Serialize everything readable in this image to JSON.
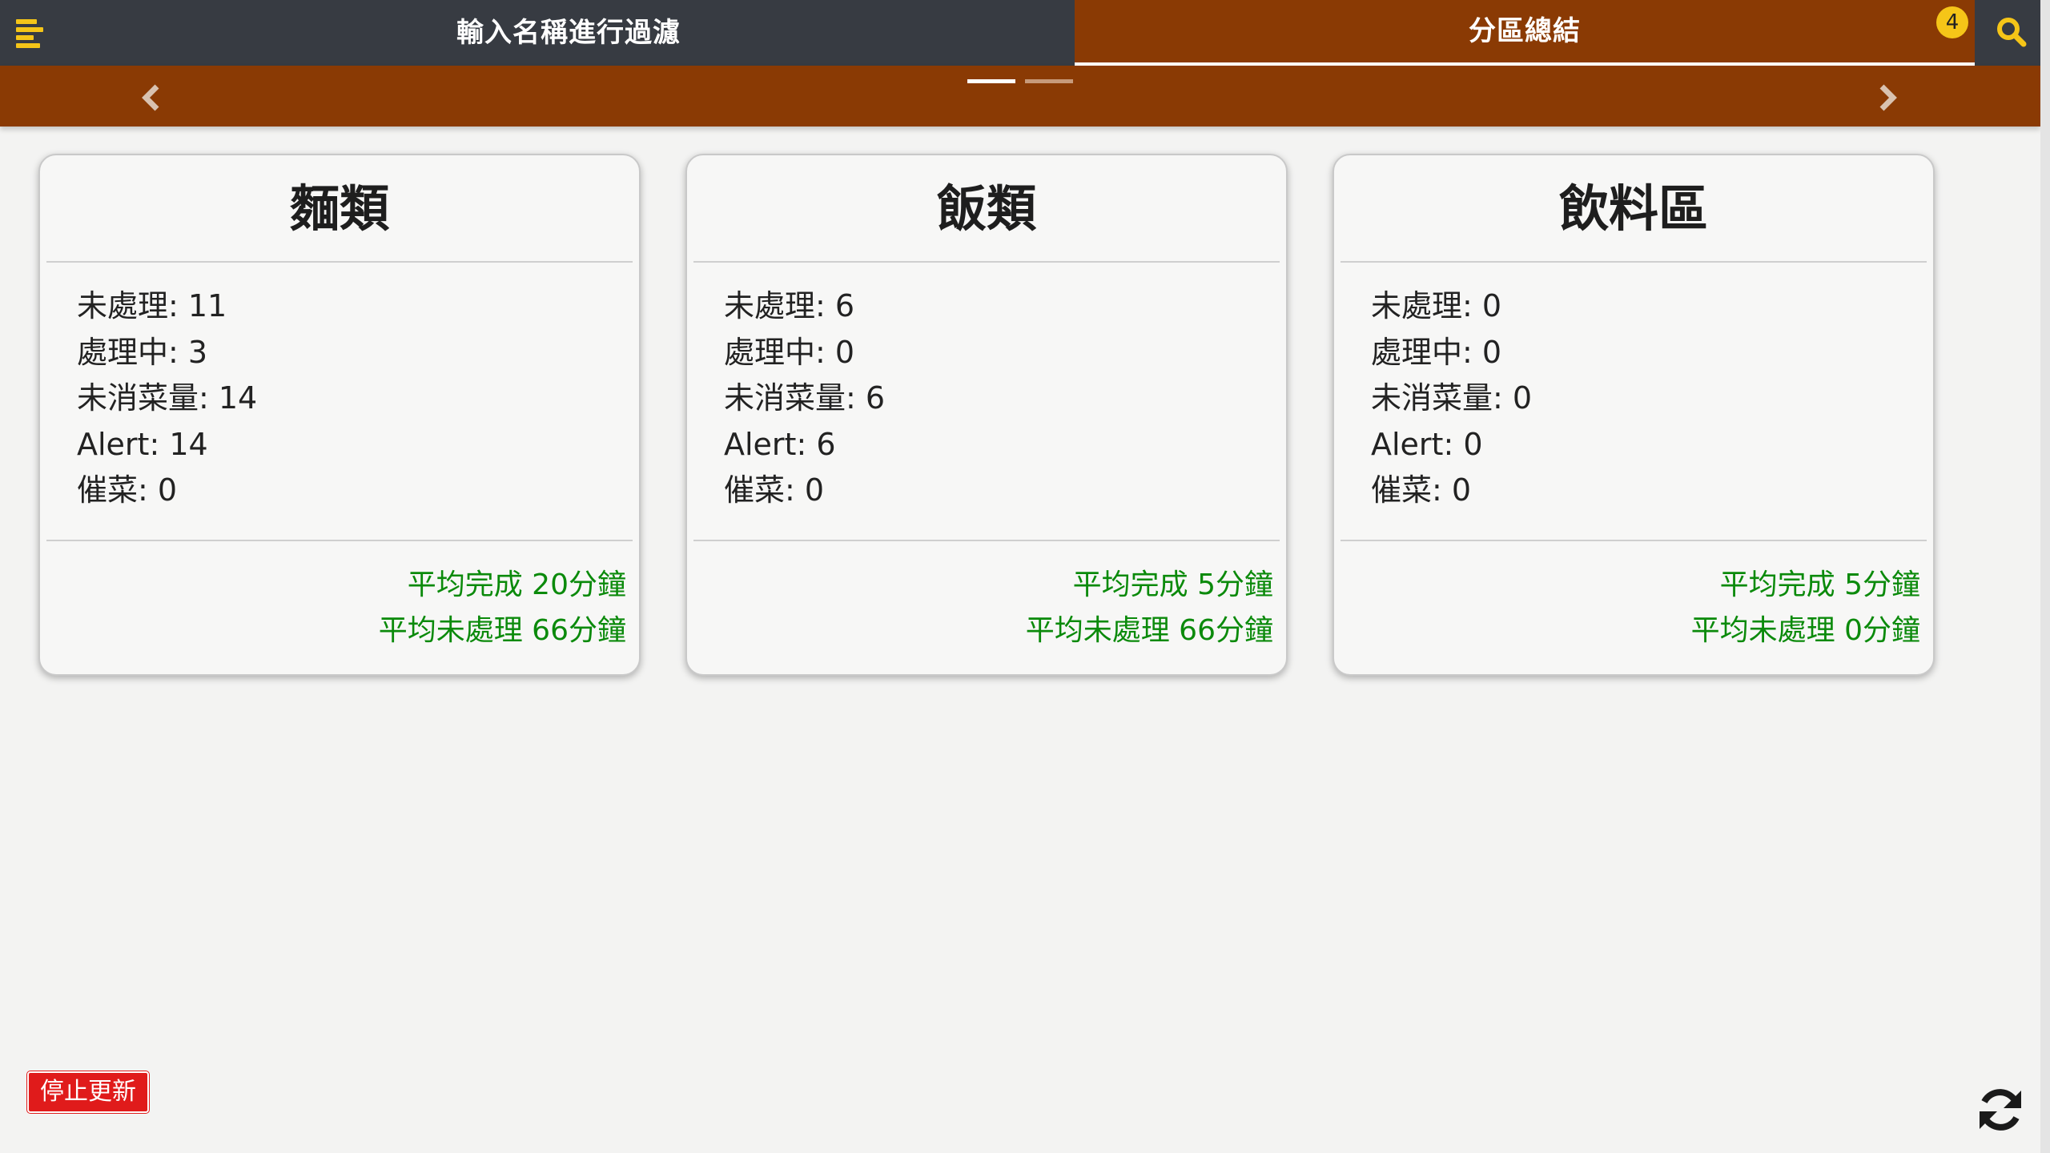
{
  "header": {
    "filter_title": "輸入名稱進行過濾",
    "summary_tab": "分區總結",
    "badge_count": "4",
    "accent_color": "#8a3a04",
    "badge_color": "#f5c518"
  },
  "slider": {
    "pages": 2,
    "active_page": 1
  },
  "cards": [
    {
      "title": "麵類",
      "stats": [
        "未處理: 11",
        "處理中: 3",
        "未消菜量: 14",
        "Alert: 14",
        "催菜: 0"
      ],
      "avg_complete": "平均完成 20分鐘",
      "avg_pending": "平均未處理 66分鐘"
    },
    {
      "title": "飯類",
      "stats": [
        "未處理: 6",
        "處理中: 0",
        "未消菜量: 6",
        "Alert: 6",
        "催菜: 0"
      ],
      "avg_complete": "平均完成 5分鐘",
      "avg_pending": "平均未處理 66分鐘"
    },
    {
      "title": "飲料區",
      "stats": [
        "未處理: 0",
        "處理中: 0",
        "未消菜量: 0",
        "Alert: 0",
        "催菜: 0"
      ],
      "avg_complete": "平均完成 5分鐘",
      "avg_pending": "平均未處理 0分鐘"
    }
  ],
  "footer": {
    "stop_label": "停止更新",
    "stop_color": "#e01b1b"
  },
  "icons": {
    "menu": "menu-icon",
    "search": "search-icon",
    "prev": "chevron-left-icon",
    "next": "chevron-right-icon",
    "refresh": "refresh-icon"
  }
}
